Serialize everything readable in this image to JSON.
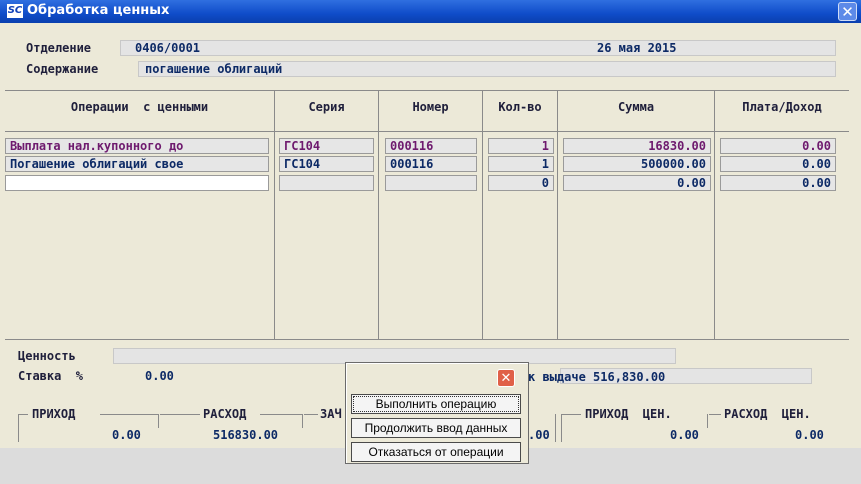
{
  "window": {
    "title": "Обработка ценных",
    "logo": "SC"
  },
  "header": {
    "department_label": "Отделение",
    "department_value": "0406/0001",
    "date": "26 мая 2015",
    "content_label": "Содержание",
    "content_value": "погашение облигаций"
  },
  "table": {
    "columns": [
      "Операции  с ценными",
      "Серия",
      "Номер",
      "Кол-во",
      "Сумма",
      "Плата/Доход"
    ],
    "rows": [
      {
        "op": "Выплата нал.купонного до",
        "series": "ГС104",
        "number": "000116",
        "qty": "1",
        "sum": "16830.00",
        "fee": "0.00"
      },
      {
        "op": "Погашение облигаций свое",
        "series": "ГС104",
        "number": "000116",
        "qty": "1",
        "sum": "500000.00",
        "fee": "0.00"
      },
      {
        "op": "",
        "series": "",
        "number": "",
        "qty": "0",
        "sum": "0.00",
        "fee": "0.00"
      }
    ]
  },
  "footer": {
    "value_label": "Ценность",
    "rate_label": "Ставка  %",
    "rate_value": "0.00",
    "payout_text": "к выдаче 516,830.00",
    "income_label": "ПРИХОД",
    "income_value": "0.00",
    "expense_label": "РАСХОД",
    "expense_value": "516830.00",
    "third_label_fragment": "ЗАЧ",
    "third_value_fragment": ".00",
    "income_val_label": "ПРИХОД  ЦЕН.",
    "income_val_value": "0.00",
    "expense_val_label": "РАСХОД  ЦЕН.",
    "expense_val_value": "0.00"
  },
  "dialog": {
    "buttons": [
      "Выполнить операцию",
      "Продолжить ввод данных",
      "Отказаться от операции"
    ]
  },
  "icons": {
    "close": "close-icon",
    "logo": "app-logo-icon"
  },
  "colors": {
    "titlebar": "#0f4cc9",
    "text_purple": "#6e1a6e",
    "text_navy": "#0d2a66"
  }
}
